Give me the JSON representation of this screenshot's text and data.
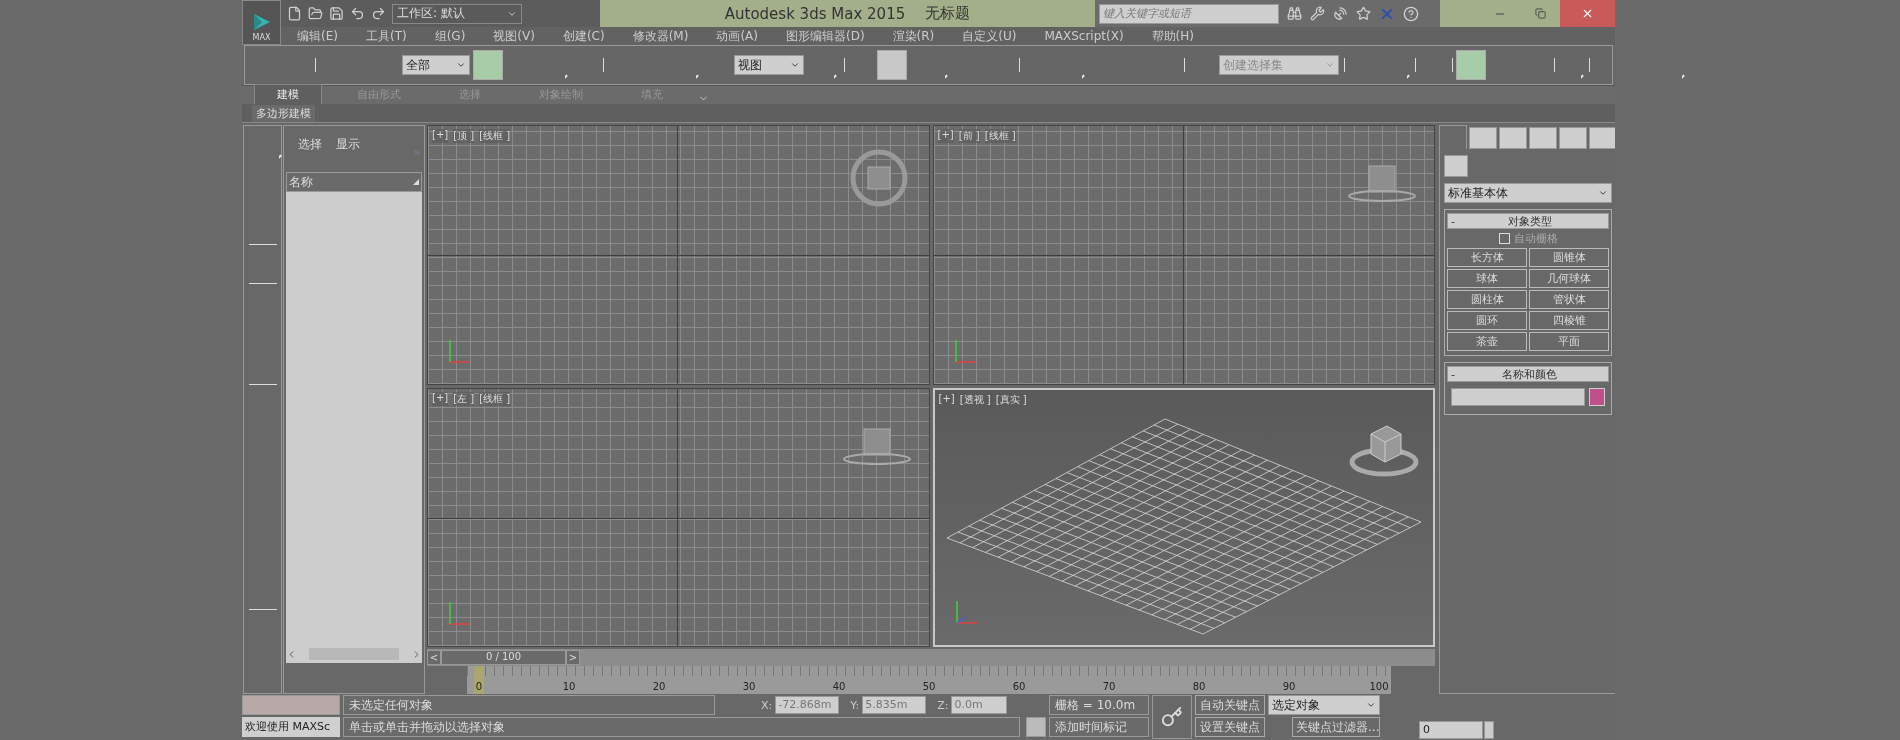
{
  "title_bar": {
    "app_button": "MAX",
    "workspace": "工作区: 默认",
    "title": "Autodesk 3ds Max  2015",
    "document": "无标题",
    "search": {
      "placeholder": "键入关键字或短语"
    }
  },
  "menu": [
    "编辑(E)",
    "工具(T)",
    "组(G)",
    "视图(V)",
    "创建(C)",
    "修改器(M)",
    "动画(A)",
    "图形编辑器(D)",
    "渲染(R)",
    "自定义(U)",
    "MAXScript(X)",
    "帮助(H)"
  ],
  "main_toolbar": {
    "selection_filter": "全部",
    "reference_coordinate": "视图",
    "named_selection": {
      "placeholder": "创建选择集"
    }
  },
  "ribbon": {
    "tabs": [
      {
        "label": "建模",
        "selected": true
      },
      {
        "label": "自由形式",
        "selected": false
      },
      {
        "label": "选择",
        "selected": false
      },
      {
        "label": "对象绘制",
        "selected": false
      },
      {
        "label": "填充",
        "selected": false
      }
    ],
    "panel": "多边形建模"
  },
  "scene_explorer": {
    "tabs": [
      "选择",
      "显示"
    ],
    "column": "名称"
  },
  "viewports": [
    {
      "kind": "top",
      "selected": false,
      "labels": [
        "[+]",
        "[顶 ]",
        "[线框 ]"
      ]
    },
    {
      "kind": "front",
      "selected": false,
      "labels": [
        "[+]",
        "[前 ]",
        "[线框 ]"
      ]
    },
    {
      "kind": "left",
      "selected": false,
      "labels": [
        "[+]",
        "[左 ]",
        "[线框 ]"
      ]
    },
    {
      "kind": "perspective",
      "selected": true,
      "labels": [
        "[+]",
        "[透视 ]",
        "[真实 ]"
      ]
    }
  ],
  "command_panel": {
    "tabs": [
      {
        "selected": true
      },
      {
        "selected": false
      },
      {
        "selected": false
      },
      {
        "selected": false
      },
      {
        "selected": false
      },
      {
        "selected": false
      }
    ],
    "category": "标准基本体",
    "object_type": {
      "title": "对象类型",
      "minus": "-",
      "autogrid": {
        "label": "自动栅格",
        "checked": false,
        "disabled": true
      },
      "buttons": [
        "长方体",
        "圆锥体",
        "球体",
        "几何球体",
        "圆柱体",
        "管状体",
        "圆环",
        "四棱锥",
        "茶壶",
        "平面"
      ]
    },
    "name_and_color": {
      "title": "名称和颜色",
      "minus": "-",
      "color": "#c0508a"
    }
  },
  "time_slider": {
    "prev": "<",
    "value": "0 / 100",
    "next": ">",
    "level": 0
  },
  "track_bar": {
    "ticks": [
      "0",
      "10",
      "20",
      "30",
      "40",
      "50",
      "60",
      "70",
      "80",
      "90",
      "100"
    ]
  },
  "status_bar": {
    "maxscript": "欢迎使用 MAXSc",
    "selection": "未选定任何对象",
    "prompt": "单击或单击并拖动以选择对象",
    "x_label": "X:",
    "x": "-72.868m",
    "y_label": "Y:",
    "y": "5.835m",
    "z_label": "Z:",
    "z": "0.0m",
    "grid": "栅格 = 10.0m",
    "add_time_tag": "添加时间标记",
    "auto_key": "自动关键点",
    "set_key": "设置关键点",
    "key_mode": "选定对象",
    "key_filters": "关键点过滤器...",
    "frame": "0"
  }
}
